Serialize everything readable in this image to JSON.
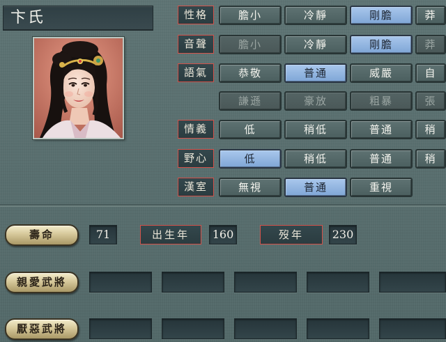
{
  "character": {
    "name": "卞氏"
  },
  "traits": [
    {
      "label": "性格",
      "options": [
        {
          "text": "膽小",
          "state": "normal"
        },
        {
          "text": "冷靜",
          "state": "normal"
        },
        {
          "text": "剛膽",
          "state": "selected"
        },
        {
          "text": "莽",
          "state": "normal"
        }
      ]
    },
    {
      "label": "音聲",
      "options": [
        {
          "text": "膽小",
          "state": "disabled"
        },
        {
          "text": "冷靜",
          "state": "normal"
        },
        {
          "text": "剛膽",
          "state": "selected"
        },
        {
          "text": "莽",
          "state": "disabled"
        }
      ]
    },
    {
      "label": "語氣",
      "options": [
        {
          "text": "恭敬",
          "state": "normal"
        },
        {
          "text": "普通",
          "state": "selected"
        },
        {
          "text": "威嚴",
          "state": "normal"
        },
        {
          "text": "自",
          "state": "normal"
        }
      ]
    },
    {
      "label": "",
      "options": [
        {
          "text": "謙遜",
          "state": "disabled"
        },
        {
          "text": "豪放",
          "state": "disabled"
        },
        {
          "text": "粗暴",
          "state": "disabled"
        },
        {
          "text": "張",
          "state": "disabled"
        }
      ]
    },
    {
      "label": "情義",
      "options": [
        {
          "text": "低",
          "state": "normal"
        },
        {
          "text": "稍低",
          "state": "normal"
        },
        {
          "text": "普通",
          "state": "normal"
        },
        {
          "text": "稍",
          "state": "normal"
        }
      ]
    },
    {
      "label": "野心",
      "options": [
        {
          "text": "低",
          "state": "selected"
        },
        {
          "text": "稍低",
          "state": "normal"
        },
        {
          "text": "普通",
          "state": "normal"
        },
        {
          "text": "稍",
          "state": "normal"
        }
      ]
    },
    {
      "label": "漢室",
      "options": [
        {
          "text": "無視",
          "state": "normal"
        },
        {
          "text": "普通",
          "state": "selected"
        },
        {
          "text": "重視",
          "state": "normal"
        }
      ]
    }
  ],
  "lifespan": {
    "button_label": "壽命",
    "value": "71",
    "birth_label": "出生年",
    "birth_value": "160",
    "death_label": "歿年",
    "death_value": "230"
  },
  "favored_generals": {
    "button_label": "親愛武將",
    "slots": [
      "",
      "",
      "",
      "",
      ""
    ]
  },
  "disliked_generals": {
    "button_label": "厭惡武將",
    "slots": [
      "",
      "",
      "",
      "",
      ""
    ]
  },
  "colors": {
    "background": "#566c6c",
    "selected": "#8fb3e0",
    "label_border": "#d4524a",
    "gold_button": "#d6c89a"
  }
}
